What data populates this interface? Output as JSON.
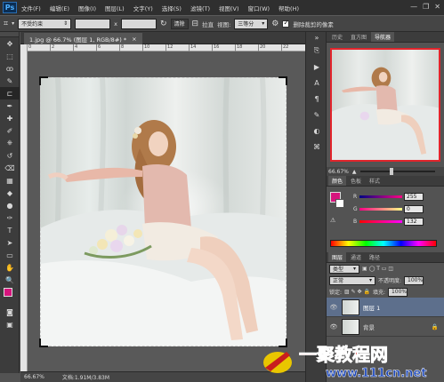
{
  "menubar": {
    "logo": "Ps",
    "items": [
      "文件(F)",
      "编辑(E)",
      "图像(I)",
      "图层(L)",
      "文字(Y)",
      "选择(S)",
      "滤镜(T)",
      "视图(V)",
      "窗口(W)",
      "帮助(H)"
    ],
    "minimize": "—",
    "restore": "❐",
    "close": "✕"
  },
  "options": {
    "ratio_select": "不受约束",
    "swap_label": "x",
    "clear_button": "清除",
    "straighten_label": "拉直",
    "view_label": "视图:",
    "view_select": "三等分",
    "delete_cropped_label": "删除裁剪的像素"
  },
  "document": {
    "tab_title": "1.jpg @ 66.7% (图层 1, RGB/8#) *",
    "tab_close": "×",
    "ruler_ticks": [
      "0",
      "2",
      "4",
      "6",
      "8",
      "10",
      "12",
      "14",
      "16",
      "18",
      "20",
      "22"
    ],
    "zoom": "66.67%",
    "doc_size": "文档:1.91M/3.83M"
  },
  "tools": {
    "icons": [
      "move-icon",
      "marquee-icon",
      "lasso-icon",
      "quick-select-icon",
      "crop-icon",
      "eyedropper-icon",
      "healing-icon",
      "brush-icon",
      "clone-stamp-icon",
      "history-brush-icon",
      "eraser-icon",
      "gradient-icon",
      "blur-icon",
      "dodge-icon",
      "pen-icon",
      "type-icon",
      "path-select-icon",
      "shape-icon",
      "hand-icon",
      "zoom-icon"
    ],
    "glyphs": [
      "✥",
      "⬚",
      "ꝏ",
      "✎",
      "⊏",
      "✒",
      "✚",
      "✐",
      "⎈",
      "↺",
      "⌫",
      "▦",
      "◆",
      "●",
      "✑",
      "T",
      "➤",
      "▭",
      "✋",
      "🔍"
    ],
    "foreground_color": "#d6147d",
    "background_color": "#ffffff"
  },
  "navigator": {
    "tabs": [
      "历史",
      "直方图",
      "导航器"
    ],
    "active_tab": "导航器",
    "zoom": "66.67%"
  },
  "color_panel": {
    "tabs": [
      "颜色",
      "色板",
      "样式"
    ],
    "r_label": "R",
    "r_value": "255",
    "g_label": "G",
    "g_value": "0",
    "b_label": "B",
    "b_value": "132"
  },
  "layers_panel": {
    "tabs": [
      "图层",
      "通道",
      "路径"
    ],
    "kind_label": "类型",
    "blend_mode": "正常",
    "opacity_label": "不透明度:",
    "opacity_value": "100%",
    "lock_label": "锁定:",
    "fill_label": "填充:",
    "fill_value": "100%",
    "layers": [
      {
        "name": "图层 1",
        "active": true
      },
      {
        "name": "背景",
        "active": false
      }
    ]
  },
  "watermark": {
    "text": "一聚教程网",
    "url": "www.111cn.net"
  }
}
